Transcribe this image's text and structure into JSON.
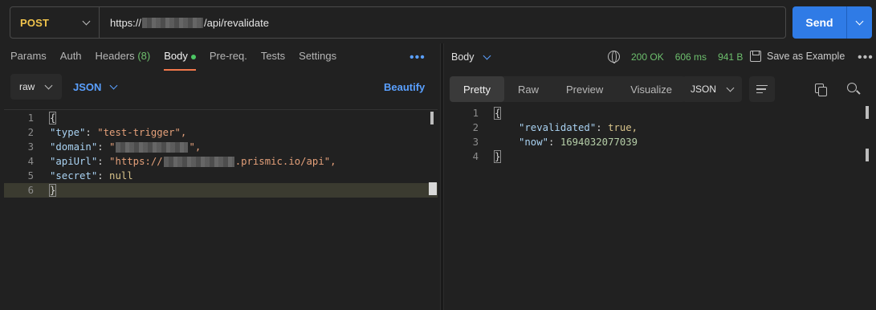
{
  "request": {
    "method": "POST",
    "url_prefix": "https://",
    "url_suffix": "/api/revalidate",
    "send_label": "Send"
  },
  "request_tabs": [
    {
      "label": "Params"
    },
    {
      "label": "Auth"
    },
    {
      "label": "Headers",
      "count": "(8)"
    },
    {
      "label": "Body",
      "active": true
    },
    {
      "label": "Pre-req."
    },
    {
      "label": "Tests"
    },
    {
      "label": "Settings"
    }
  ],
  "body_options": {
    "mode": "raw",
    "language": "JSON",
    "beautify_label": "Beautify"
  },
  "request_body": {
    "lines": [
      {
        "n": "1",
        "text": "{"
      },
      {
        "n": "2",
        "key": "\"type\"",
        "value": "\"test-trigger\","
      },
      {
        "n": "3",
        "key": "\"domain\"",
        "value_prefix": "\"",
        "value_suffix": "\","
      },
      {
        "n": "4",
        "key": "\"apiUrl\"",
        "value_prefix": "\"https://",
        "value_suffix": ".prismic.io/api\","
      },
      {
        "n": "5",
        "key": "\"secret\"",
        "value": "null"
      },
      {
        "n": "6",
        "text": "}"
      }
    ]
  },
  "response": {
    "section_label": "Body",
    "status": "200 OK",
    "time": "606 ms",
    "size": "941 B",
    "save_label": "Save as Example",
    "view_tabs": [
      "Pretty",
      "Raw",
      "Preview",
      "Visualize"
    ],
    "active_view": "Pretty",
    "format": "JSON",
    "lines": [
      {
        "n": "1",
        "text": "{"
      },
      {
        "n": "2",
        "key": "\"revalidated\"",
        "value": "true,"
      },
      {
        "n": "3",
        "key": "\"now\"",
        "value": "1694032077039"
      },
      {
        "n": "4",
        "text": "}"
      }
    ]
  },
  "colors": {
    "accent": "#2f7be6",
    "method": "#f0c34c",
    "status_ok": "#6dbf6d",
    "active_tab_underline": "#f2784b"
  }
}
